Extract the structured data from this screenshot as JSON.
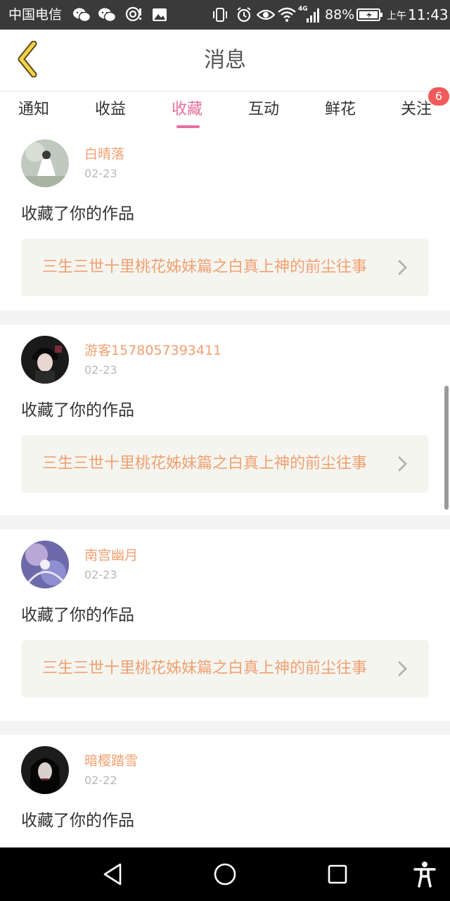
{
  "status_bar": {
    "carrier": "中国电信",
    "battery": "88%",
    "time_period": "上午",
    "time": "11:43",
    "network_type": "4G",
    "icons": [
      "wechat-icon",
      "wechat-icon",
      "hotspot-icon",
      "image-icon",
      "vibrate-icon",
      "alarm-icon",
      "eye-icon",
      "wifi-icon",
      "signal-icon",
      "battery-charging-icon"
    ]
  },
  "header": {
    "title": "消息",
    "back_icon": "chevron-left-icon"
  },
  "tabs": {
    "items": [
      {
        "label": "通知",
        "active": false
      },
      {
        "label": "收益",
        "active": false
      },
      {
        "label": "收藏",
        "active": true
      },
      {
        "label": "互动",
        "active": false
      },
      {
        "label": "鲜花",
        "active": false
      },
      {
        "label": "关注",
        "active": false
      }
    ],
    "badge": "6",
    "active_color": "#e8709e"
  },
  "feed": {
    "items": [
      {
        "user": "白晴落",
        "date": "02-23",
        "action": "收藏了你的作品",
        "work_title": "三生三世十里桃花姊妹篇之白真上神的前尘往事"
      },
      {
        "user": "游客1578057393411",
        "date": "02-23",
        "action": "收藏了你的作品",
        "work_title": "三生三世十里桃花姊妹篇之白真上神的前尘往事"
      },
      {
        "user": "南宫幽月",
        "date": "02-23",
        "action": "收藏了你的作品",
        "work_title": "三生三世十里桃花姊妹篇之白真上神的前尘往事"
      },
      {
        "user": "暗樱踏雪",
        "date": "02-22",
        "action": "收藏了你的作品",
        "work_title": ""
      }
    ],
    "accent_color": "#f0a070"
  },
  "nav_bar": {
    "icons": [
      "back-triangle-icon",
      "home-circle-icon",
      "recents-square-icon",
      "accessibility-icon"
    ]
  }
}
